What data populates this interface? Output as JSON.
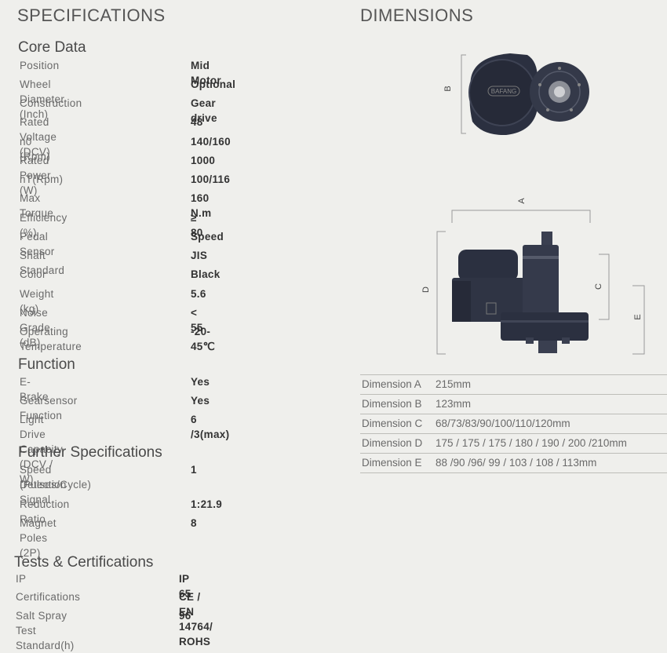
{
  "headings": {
    "specifications": "SPECIFICATIONS",
    "dimensions": "DIMENSIONS"
  },
  "core": {
    "title": "Core Data",
    "rows": [
      {
        "label": "Position",
        "value": "Mid Motor"
      },
      {
        "label": "Wheel Diameter (Inch)",
        "value": "Optional"
      },
      {
        "label": "Construction",
        "value": "Gear drive"
      },
      {
        "label": "Rated Voltage (DCV)",
        "value": "48"
      },
      {
        "label": "n0 (Rpm)",
        "value": "140/160"
      },
      {
        "label": "Rated Power (W)",
        "value": "1000"
      },
      {
        "label": "nT(Rpm)",
        "value": "100/116"
      },
      {
        "label": "Max Torque",
        "value": "160 N.m"
      },
      {
        "label": "Efficiency (%)",
        "value": "≥ 80"
      },
      {
        "label": "Pedal Sensor",
        "value": "Speed"
      },
      {
        "label": "Shaft Standard",
        "value": "JIS"
      },
      {
        "label": "Color",
        "value": "Black"
      },
      {
        "label": "Weight (kg)",
        "value": "5.6"
      },
      {
        "label": "Noise Grade (dB)",
        "value": "< 55"
      },
      {
        "label": "Operating Temperature",
        "value": "-20-45℃"
      }
    ]
  },
  "function": {
    "title": "Function",
    "rows": [
      {
        "label": "E-Brake",
        "value": "Yes"
      },
      {
        "label": "Gearsensor Function",
        "value": "Yes"
      },
      {
        "label": "Light Drive Capacity (DCV / W)",
        "value": "6 /3(max)"
      }
    ]
  },
  "further": {
    "title": "Further Specifications",
    "rows": [
      {
        "label": "Speed Detection Signal",
        "label2": "(Pulses/Cycle)",
        "value": "1"
      },
      {
        "label": "Reduction Ratio",
        "value": "1:21.9"
      },
      {
        "label": "Magnet Poles (2P)",
        "value": "8"
      }
    ]
  },
  "tests": {
    "title": "Tests & Certifications",
    "rows": [
      {
        "label": "IP",
        "value": "IP 65"
      },
      {
        "label": "Certifications",
        "value": "CE / EN 14764/ ROHS"
      },
      {
        "label": "Salt Spray Test Standard(h)",
        "value": "96"
      }
    ]
  },
  "dimensions": {
    "diagram_labels": {
      "a": "A",
      "b": "B",
      "c": "C",
      "d": "D",
      "e": "E"
    },
    "logo_text": "BAFANG",
    "rows": [
      {
        "label": "Dimension A",
        "value": "215mm"
      },
      {
        "label": "Dimension B",
        "value": "123mm"
      },
      {
        "label": "Dimension C",
        "value": "68/73/83/90/100/110/120mm"
      },
      {
        "label": "Dimension D",
        "value": "175 / 175 / 175 / 180 / 190 / 200 /210mm"
      },
      {
        "label": "Dimension E",
        "value": "88 /90 /96/ 99 / 103 / 108 / 113mm"
      }
    ]
  },
  "colors": {
    "background": "#efefec",
    "motor": "#2b3040",
    "bracket": "#9a9a9a"
  }
}
